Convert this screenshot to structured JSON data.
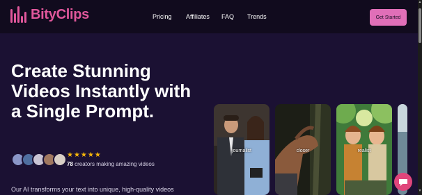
{
  "brand": {
    "name": "BityClips"
  },
  "nav": {
    "links": [
      "Pricing",
      "Affiliates",
      "FAQ",
      "Trends"
    ]
  },
  "cta": {
    "label": "Get Started"
  },
  "hero": {
    "headline": "Create Stunning Videos Instantly with a Single Prompt.",
    "rating_stars": "★★★★★",
    "creators_count": "78",
    "creators_text": " creators making amazing videos",
    "subtext": "Our AI transforms your text into unique, high-quality videos"
  },
  "cards": [
    {
      "label": "journalist"
    },
    {
      "label": "closer"
    },
    {
      "label": "realist"
    }
  ],
  "colors": {
    "brand": "#e0579b",
    "cta": "#e06fb8",
    "background": "#1b1133",
    "navbar": "#110b1e",
    "stars": "#f5b50a"
  },
  "icons": {
    "chat": "chat-icon"
  }
}
